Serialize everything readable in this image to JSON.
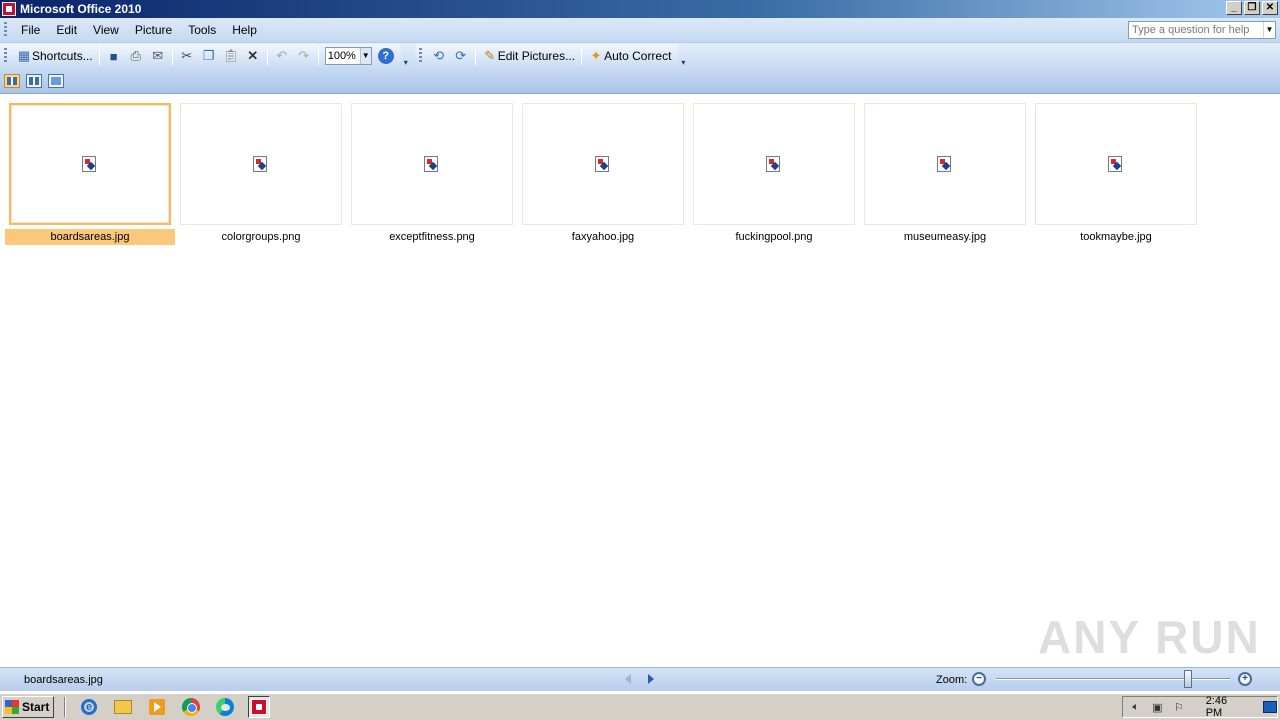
{
  "window": {
    "title": "Microsoft Office 2010",
    "min": "_",
    "restore": "❐",
    "close": "✕"
  },
  "menu": {
    "items": [
      {
        "label": "File",
        "key": "F"
      },
      {
        "label": "Edit",
        "key": "E"
      },
      {
        "label": "View",
        "key": "V"
      },
      {
        "label": "Picture",
        "key": "P"
      },
      {
        "label": "Tools",
        "key": "T"
      },
      {
        "label": "Help",
        "key": "H"
      }
    ],
    "help_placeholder": "Type a question for help"
  },
  "toolbar": {
    "shortcuts_label": "Shortcuts...",
    "zoom_value": "100%",
    "edit_pictures_label": "Edit Pictures...",
    "auto_correct_label": "Auto Correct"
  },
  "thumbnails": [
    {
      "name": "boardsareas.jpg",
      "selected": true
    },
    {
      "name": "colorgroups.png",
      "selected": false
    },
    {
      "name": "exceptfitness.png",
      "selected": false
    },
    {
      "name": "faxyahoo.jpg",
      "selected": false
    },
    {
      "name": "fuckingpool.png",
      "selected": false
    },
    {
      "name": "museumeasy.jpg",
      "selected": false
    },
    {
      "name": "tookmaybe.jpg",
      "selected": false
    }
  ],
  "status": {
    "current_file": "boardsareas.jpg",
    "zoom_label": "Zoom:",
    "zoom_level": 0.82
  },
  "watermark": "ANY RUN",
  "taskbar": {
    "start_label": "Start",
    "clock": "2:46 PM"
  },
  "colors": {
    "selection": "#fbc87b",
    "title_gradient_start": "#0a246a",
    "menubar": "#c4d9f1"
  }
}
